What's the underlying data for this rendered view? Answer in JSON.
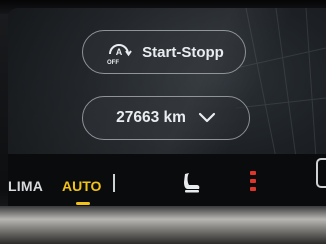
{
  "start_stopp": {
    "label": "Start-Stopp",
    "icon": "auto-start-stop-off-icon",
    "icon_text": "OFF"
  },
  "odometer": {
    "value": "27663 km"
  },
  "climate_bar": {
    "klima_label": "LIMA",
    "auto_label": "AUTO",
    "auto_color": "#f2c218",
    "seat_icon": "seat-heating-icon",
    "heat_icon": "heat-level-icon",
    "heat_color": "#e0352b"
  }
}
